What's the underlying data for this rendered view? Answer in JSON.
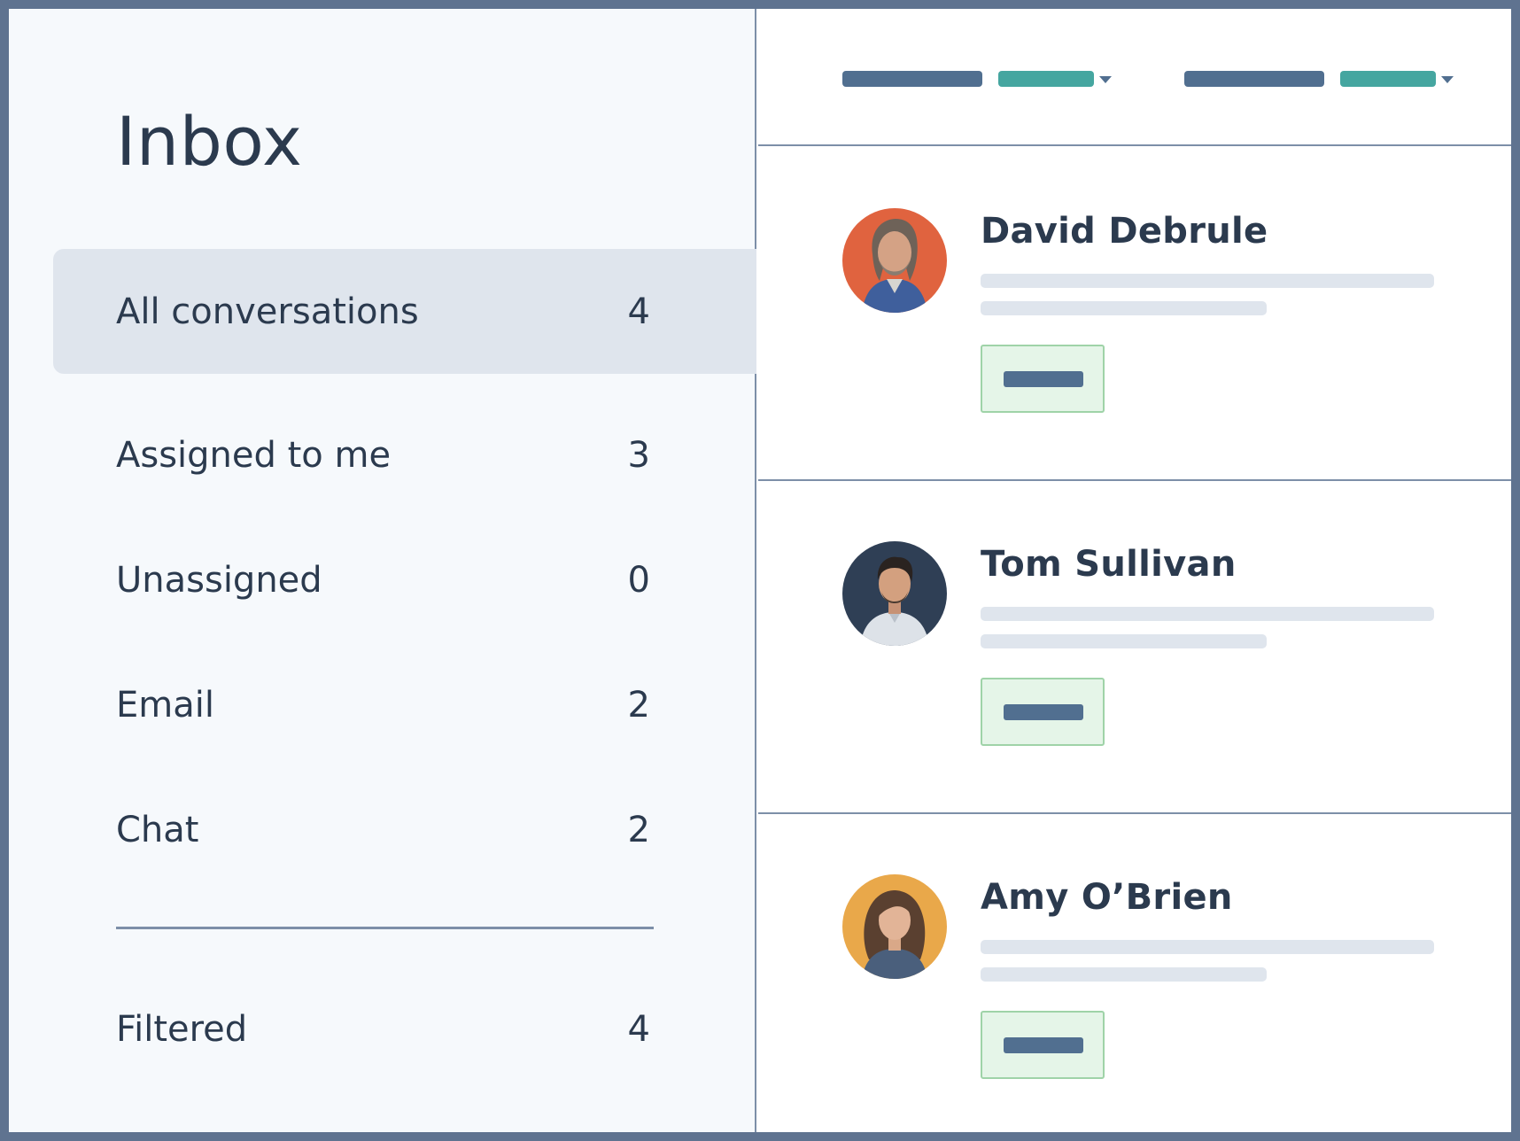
{
  "inbox": {
    "title": "Inbox",
    "nav": [
      {
        "label": "All conversations",
        "count": "4",
        "active": true
      },
      {
        "label": "Assigned to me",
        "count": "3",
        "active": false
      },
      {
        "label": "Unassigned",
        "count": "0",
        "active": false
      },
      {
        "label": "Email",
        "count": "2",
        "active": false
      },
      {
        "label": "Chat",
        "count": "2",
        "active": false
      }
    ],
    "filtered": {
      "label": "Filtered",
      "count": "4"
    }
  },
  "conversations": [
    {
      "name": "David Debrule",
      "avatar_bg": "#e0633f"
    },
    {
      "name": "Tom Sullivan",
      "avatar_bg": "#2f3f55"
    },
    {
      "name": "Amy O’Brien",
      "avatar_bg": "#e9a84a"
    }
  ],
  "colors": {
    "accent_teal": "#45a6a0",
    "slate": "#516f90",
    "active_row": "#dfe5ed",
    "button_green": "#e5f5e8"
  }
}
